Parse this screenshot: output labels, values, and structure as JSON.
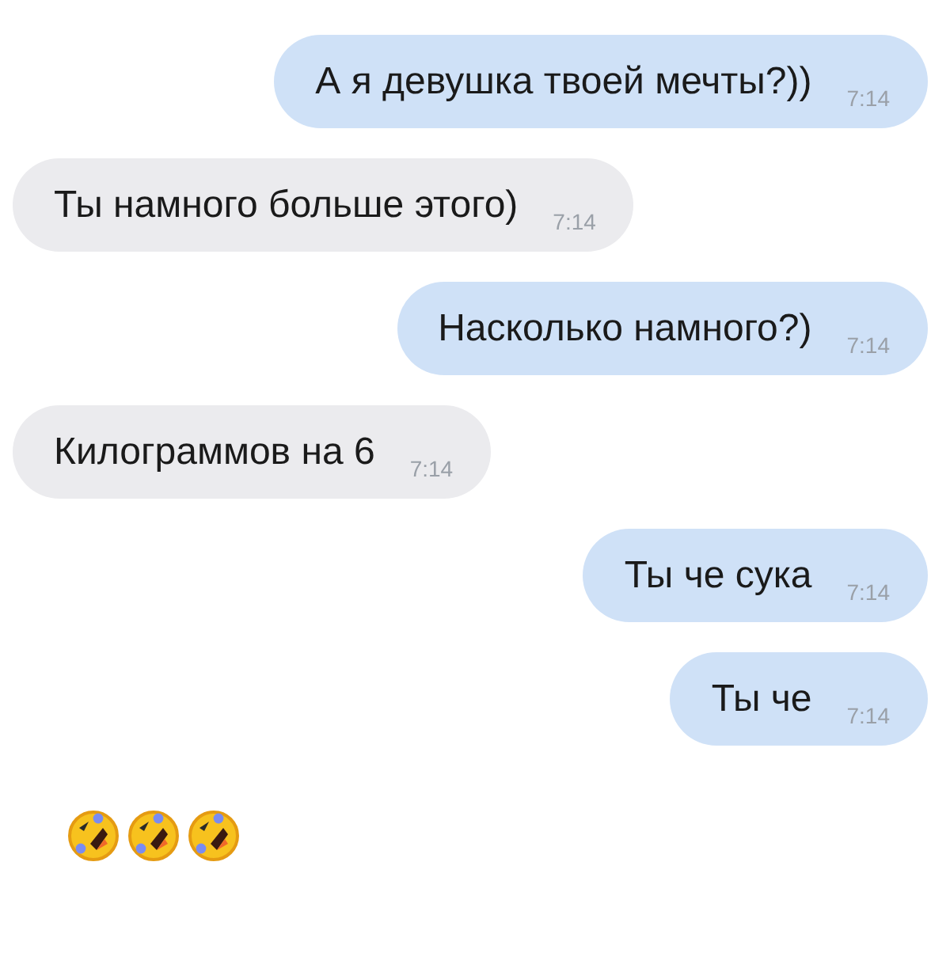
{
  "messages": [
    {
      "kind": "outgoing",
      "text": "А я девушка твоей мечты?))",
      "time": "7:14"
    },
    {
      "kind": "incoming",
      "text": "Ты намного больше этого)",
      "time": "7:14"
    },
    {
      "kind": "outgoing",
      "text": "Насколько намного?)",
      "time": "7:14"
    },
    {
      "kind": "incoming",
      "text": "Килограммов на 6",
      "time": "7:14"
    },
    {
      "kind": "outgoing",
      "text": "Ты че сука",
      "time": "7:14"
    },
    {
      "kind": "outgoing",
      "text": "Ты че",
      "time": "7:14"
    }
  ],
  "caption": [
    {
      "kind": "rofl"
    },
    {
      "kind": "rofl"
    },
    {
      "kind": "rofl"
    }
  ]
}
